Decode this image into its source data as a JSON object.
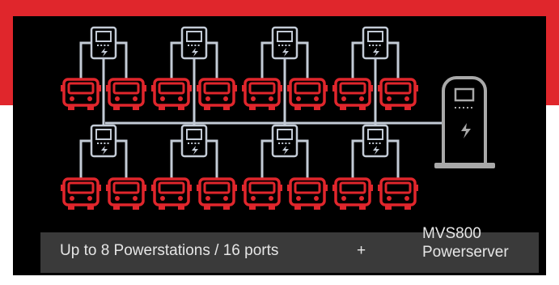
{
  "colors": {
    "red": "#e0262c",
    "panel": "#000000",
    "line": "#c3cbd6",
    "server": "#a9a9a9",
    "caption_bar": "#3a3a3a",
    "caption_text": "#e6e6e6"
  },
  "icons": {
    "station": "powerstation-icon",
    "bus": "bus-icon",
    "server": "powerserver-icon"
  },
  "diagram": {
    "powerstation_count": 8,
    "bus_count": 16,
    "powerserver_count": 1
  },
  "caption": {
    "left": "Up to 8 Powerstations / 16 ports",
    "plus": "+",
    "right_line1": "MVS800",
    "right_line2": "Powerserver"
  }
}
